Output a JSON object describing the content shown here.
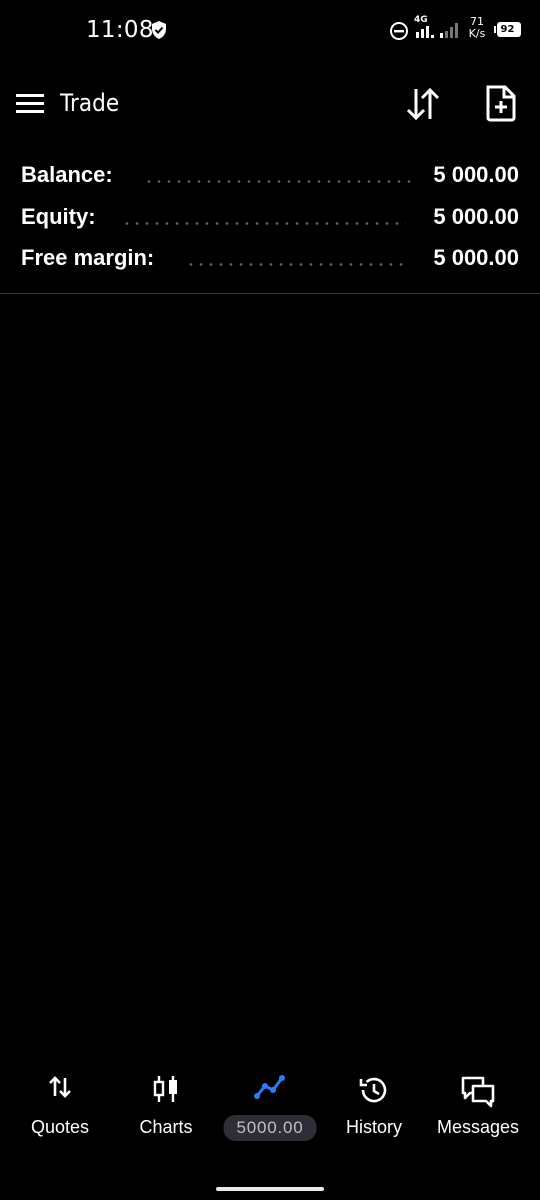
{
  "status_bar": {
    "time": "11:08",
    "network_type": "4G",
    "speed_value": "71",
    "speed_unit": "K/s",
    "battery": "92"
  },
  "app_bar": {
    "title": "Trade",
    "menu_icon": "hamburger-menu-icon",
    "sort_icon": "sort-arrows-icon",
    "new_order_icon": "new-document-icon"
  },
  "summary": {
    "rows": [
      {
        "label": "Balance:",
        "value": "5 000.00"
      },
      {
        "label": "Equity:",
        "value": "5 000.00"
      },
      {
        "label": "Free margin:",
        "value": "5 000.00"
      }
    ]
  },
  "bottom_nav": {
    "items": [
      {
        "label": "Quotes",
        "icon": "quotes-arrows-icon",
        "active": false
      },
      {
        "label": "Charts",
        "icon": "candlestick-chart-icon",
        "active": false
      },
      {
        "label": "5000.00",
        "icon": "trade-line-icon",
        "active": true
      },
      {
        "label": "History",
        "icon": "history-clock-icon",
        "active": false
      },
      {
        "label": "Messages",
        "icon": "messages-chat-icon",
        "active": false
      }
    ]
  },
  "colors": {
    "background": "#000000",
    "text": "#ffffff",
    "accent": "#2f7bf5",
    "pill_bg": "#2e2f36",
    "dots": "#5f5f5f"
  }
}
